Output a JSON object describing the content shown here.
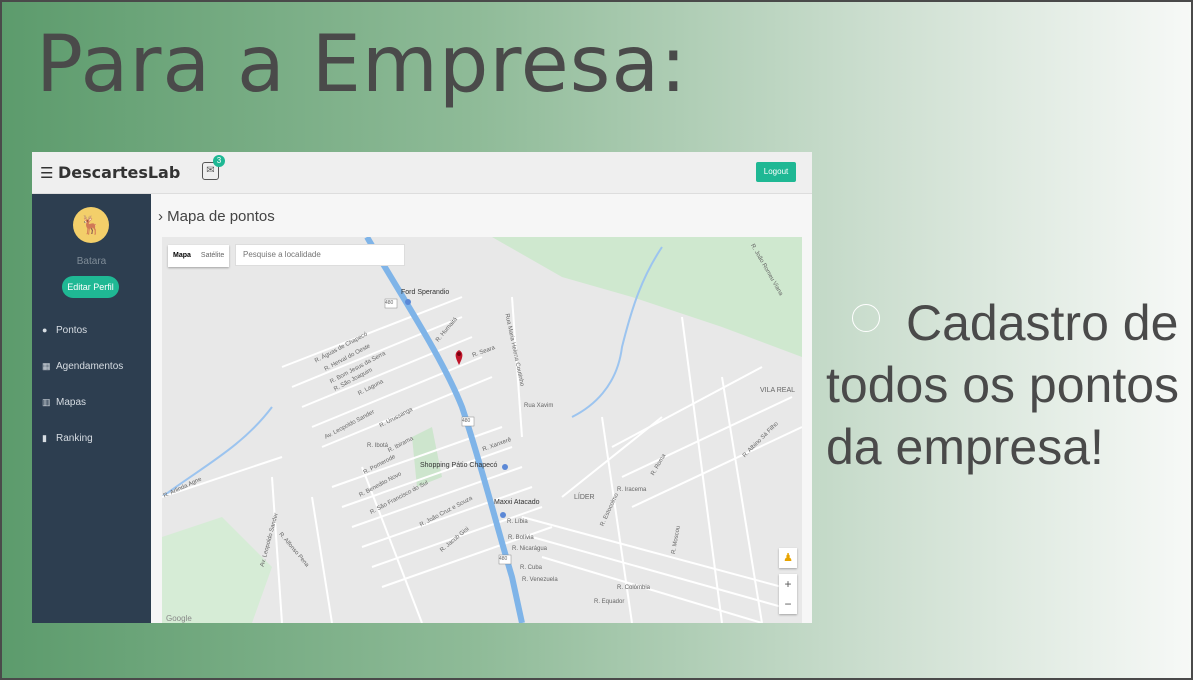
{
  "slide": {
    "title": "Para a Empresa:",
    "bullet_line1": "Cadastro de",
    "bullet_line2": "todos os pontos",
    "bullet_line3": "da empresa!"
  },
  "app": {
    "brand": "DescartesLab",
    "notification_count": "3",
    "logout_label": "Logout",
    "user": {
      "name": "Batara",
      "edit_label": "Editar Perfil"
    },
    "menu": [
      {
        "label": "Pontos",
        "icon": "map-marker-icon"
      },
      {
        "label": "Agendamentos",
        "icon": "calendar-icon"
      },
      {
        "label": "Mapas",
        "icon": "map-icon"
      },
      {
        "label": "Ranking",
        "icon": "bar-chart-icon"
      }
    ],
    "page_title": "Mapa de pontos",
    "map": {
      "type_map": "Mapa",
      "type_satellite": "Satélite",
      "search_placeholder": "Pesquise a localidade",
      "places": {
        "ford": "Ford Sperandio",
        "shopping": "Shopping Pátio Chapecó",
        "maxxi": "Maxxi Atacado",
        "vila_real": "VILA REAL",
        "lider": "LÍDER",
        "google": "Google"
      },
      "streets": {
        "s1": "R. Águas de Chapecó",
        "s2": "R. Herval do Oeste",
        "s3": "R. Bom Jesus da Serra",
        "s4": "R. São Joaquim",
        "s5": "R. Laguna",
        "s6": "R. Humaitá",
        "s7": "R. Seara",
        "s8": "Rua Maria Helena Coutinho",
        "s9": "Rua Xavim",
        "s10": "Av. Leopoldo Sander",
        "s11": "R. Urussanga",
        "s12": "R. Ibirama",
        "s13": "R. Xanxerê",
        "s14": "R. Pomerode",
        "s15": "R. Benedito Novo",
        "s16": "R. São Francisco do Sul",
        "s17": "R. Jacob Gisi",
        "s18": "R. Líbia",
        "s19": "R. Bolívia",
        "s20": "R. Nicarágua",
        "s21": "R. Cuba",
        "s22": "R. Venezuela",
        "s23": "R. Colômbia",
        "s24": "R. Equador",
        "s25": "R. Iracema",
        "s26": "R. Estocolmo",
        "s27": "R. Moscou",
        "s28": "R. Albino Sá Filho",
        "s29": "R. João Romeu Viana",
        "s30": "R. Arlinda Agne",
        "s31": "R. Alfonso Pena",
        "s32": "Av. Leopoldo Sander",
        "s33": "R. Ibotá",
        "s34": "R. Roma",
        "s35": "R. João Cruz e Souza",
        "badge_480": "480"
      }
    }
  },
  "colors": {
    "accent": "#1fb894",
    "sidebar": "#2d3e50",
    "avatar": "#f3cf6a",
    "highway": "#7fb4e8",
    "marker": "#c0152a"
  }
}
